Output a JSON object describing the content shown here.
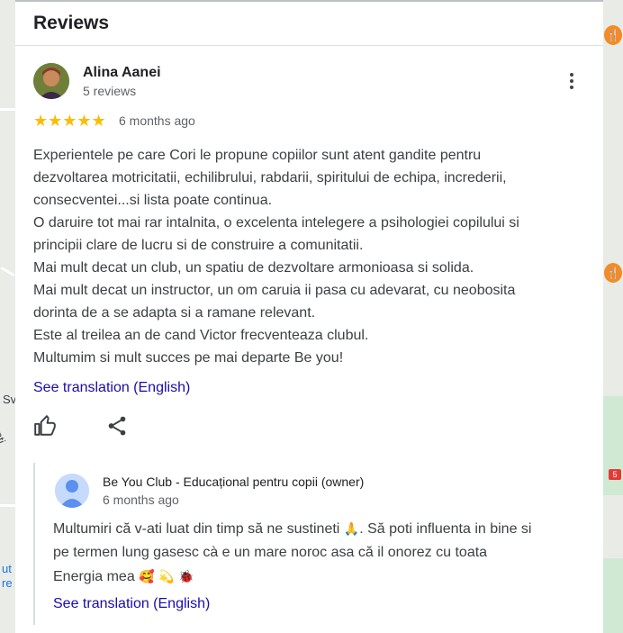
{
  "section_title": "Reviews",
  "review": {
    "reviewer_name": "Alina Aanei",
    "reviewer_reviews": "5 reviews",
    "stars": "★★★★★",
    "rating": 5,
    "time_ago": "6 months ago",
    "text_lines": [
      "Experientele pe care Cori le propune copiilor sunt atent gandite pentru",
      "dezvoltarea motricitatii, echilibrului, rabdarii, spiritului de echipa, increderii,",
      "consecventei...si lista poate continua.",
      "O daruire tot mai rar intalnita, o excelenta intelegere a psihologiei copilului si",
      "principii clare de lucru si de construire a comunitatii.",
      "Mai mult decat un club, un spatiu de dezvoltare armonioasa si solida.",
      "Mai mult decat un instructor, un om caruia ii pasa cu adevarat, cu neobosita",
      "dorinta de a se adapta si a ramane relevant.",
      "Este al treilea an de cand Victor frecventeaza clubul.",
      "Multumim si mult succes pe mai departe Be you!"
    ],
    "see_translation": "See translation (English)"
  },
  "owner_reply": {
    "name": "Be You Club - Educațional pentru copii (owner)",
    "time_ago": "6 months ago",
    "line1_a": "Multumiri că v-ati luat din timp să ne sustineti ",
    "line1_emoji": "🙏",
    "line1_b": ". Să poti influenta in bine si",
    "line2": "pe termen lung gasesc cà e un mare noroc asa că il onorez cu toata",
    "line3_a": "Energia mea ",
    "line3_emoji1": "🥰",
    "line3_emoji2": "💫",
    "line3_emoji3": "🐞",
    "see_translation": "See translation (English)"
  },
  "map": {
    "left_labels": [
      "Sv",
      "enti",
      "ut",
      "re"
    ],
    "route_badge": "5"
  },
  "colors": {
    "link": "#1a0dab",
    "star": "#fbbc04",
    "poi": "#f28c28"
  }
}
